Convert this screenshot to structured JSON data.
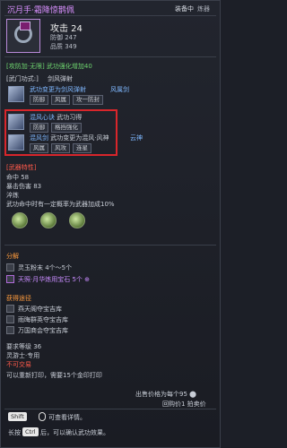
{
  "header": {
    "title": "沉月手·霜降惊鹊佩",
    "equipped": "装备中",
    "compare": "炼器"
  },
  "item": {
    "stat_main": "攻击 24",
    "stat_sub1": "防御 247",
    "stat_sub2": "品质 349"
  },
  "sections": {
    "set_line": "[攻防加·无限] 武功强化增加40",
    "trait_label": "[武门功式:]",
    "trait_value": "剑风弹射",
    "skills": [
      {
        "name": "剑风弹射",
        "desc": "武功变更为剑风弹射",
        "tag": "风属剑",
        "chips": [
          "防御",
          "连击",
          "强力爆发"
        ],
        "chips2": [
          "防御",
          "风属",
          "攻一防封"
        ]
      },
      {
        "name": "混风心诀",
        "desc": "武功习得",
        "chips": [
          "防御",
          "格挡强化"
        ]
      },
      {
        "name": "混风剑",
        "desc": "武功变更为混风·风神",
        "tag": "云神",
        "chips": [
          "风属",
          "风攻",
          "连星"
        ]
      }
    ],
    "special_title": "[武器特性]",
    "special_lines": [
      "命中 58",
      "暴击伤害 83",
      "淬炼",
      "武功命中时有一定概率为武器加成10%"
    ],
    "decompose_title": "分解",
    "decompose_items": [
      "灵玉粉末 4个～5个",
      "天照·月华炼用宝石 5个 ⊕"
    ],
    "source_title": "获得途径",
    "sources": [
      "燕天阁夺宝吉库",
      "雨晦群英夺宝吉库",
      "万国商会夺宝吉库"
    ],
    "req_level": "要求等级 36",
    "req_school": "灵游士·专用",
    "bind": "不可交易",
    "repair_note": "可以重新打印，需要15个金印打印",
    "price_line1": "出售价格为每个95 ⬤",
    "price_line2": "回购价1 拍卖价",
    "hint_key": "Shift",
    "hint_text": "可查看详情。",
    "hint2_key": "Ctrl",
    "hint2_pre": "长按",
    "hint2_text": "后，可以确认武功效果。"
  },
  "colors": {
    "title": "#d990ff",
    "highlight_box": "#d9262b",
    "green": "#6ed46e"
  }
}
